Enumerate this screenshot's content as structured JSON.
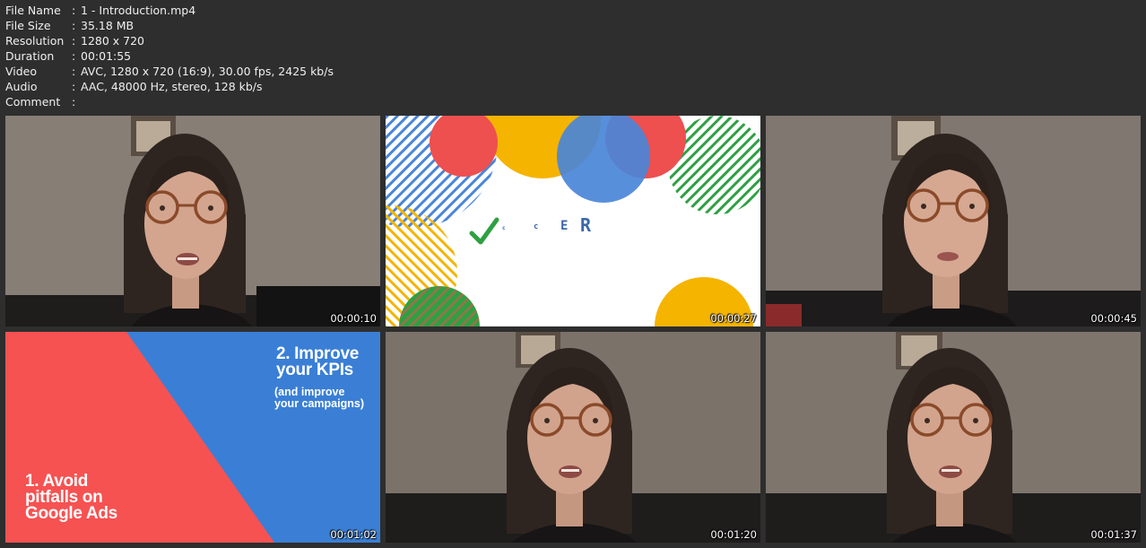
{
  "file_info": {
    "rows": [
      {
        "label": "File Name",
        "value": "1 - Introduction.mp4"
      },
      {
        "label": "File Size",
        "value": "35.18 MB"
      },
      {
        "label": "Resolution",
        "value": "1280 x 720"
      },
      {
        "label": "Duration",
        "value": "00:01:55"
      },
      {
        "label": "Video",
        "value": "AVC, 1280 x 720 (16:9), 30.00 fps, 2425 kb/s"
      },
      {
        "label": "Audio",
        "value": "AAC, 48000 Hz, stereo, 128 kb/s"
      },
      {
        "label": "Comment",
        "value": ""
      }
    ],
    "separator": ":"
  },
  "thumbnails": [
    {
      "timestamp": "00:00:10",
      "scene": "presenter"
    },
    {
      "timestamp": "00:00:27",
      "scene": "logo-slide"
    },
    {
      "timestamp": "00:00:45",
      "scene": "presenter"
    },
    {
      "timestamp": "00:01:02",
      "scene": "text-slide"
    },
    {
      "timestamp": "00:01:20",
      "scene": "presenter"
    },
    {
      "timestamp": "00:01:37",
      "scene": "presenter"
    }
  ],
  "logo_slide": {
    "letters": [
      "c",
      "c",
      "E",
      "R"
    ],
    "colors": {
      "red": "#ee4f4f",
      "yellow": "#f5b400",
      "blue": "#4a86d8",
      "green": "#2ea043"
    }
  },
  "text_slide": {
    "title_right_line1": "2. Improve",
    "title_right_line2": "your KPIs",
    "subtitle_line1": "(and improve",
    "subtitle_line2": "your campaigns)",
    "title_left_line1": "1. Avoid",
    "title_left_line2": "pitfalls on",
    "title_left_line3": "Google Ads",
    "colors": {
      "red": "#f65252",
      "blue": "#3a7fd5"
    }
  }
}
